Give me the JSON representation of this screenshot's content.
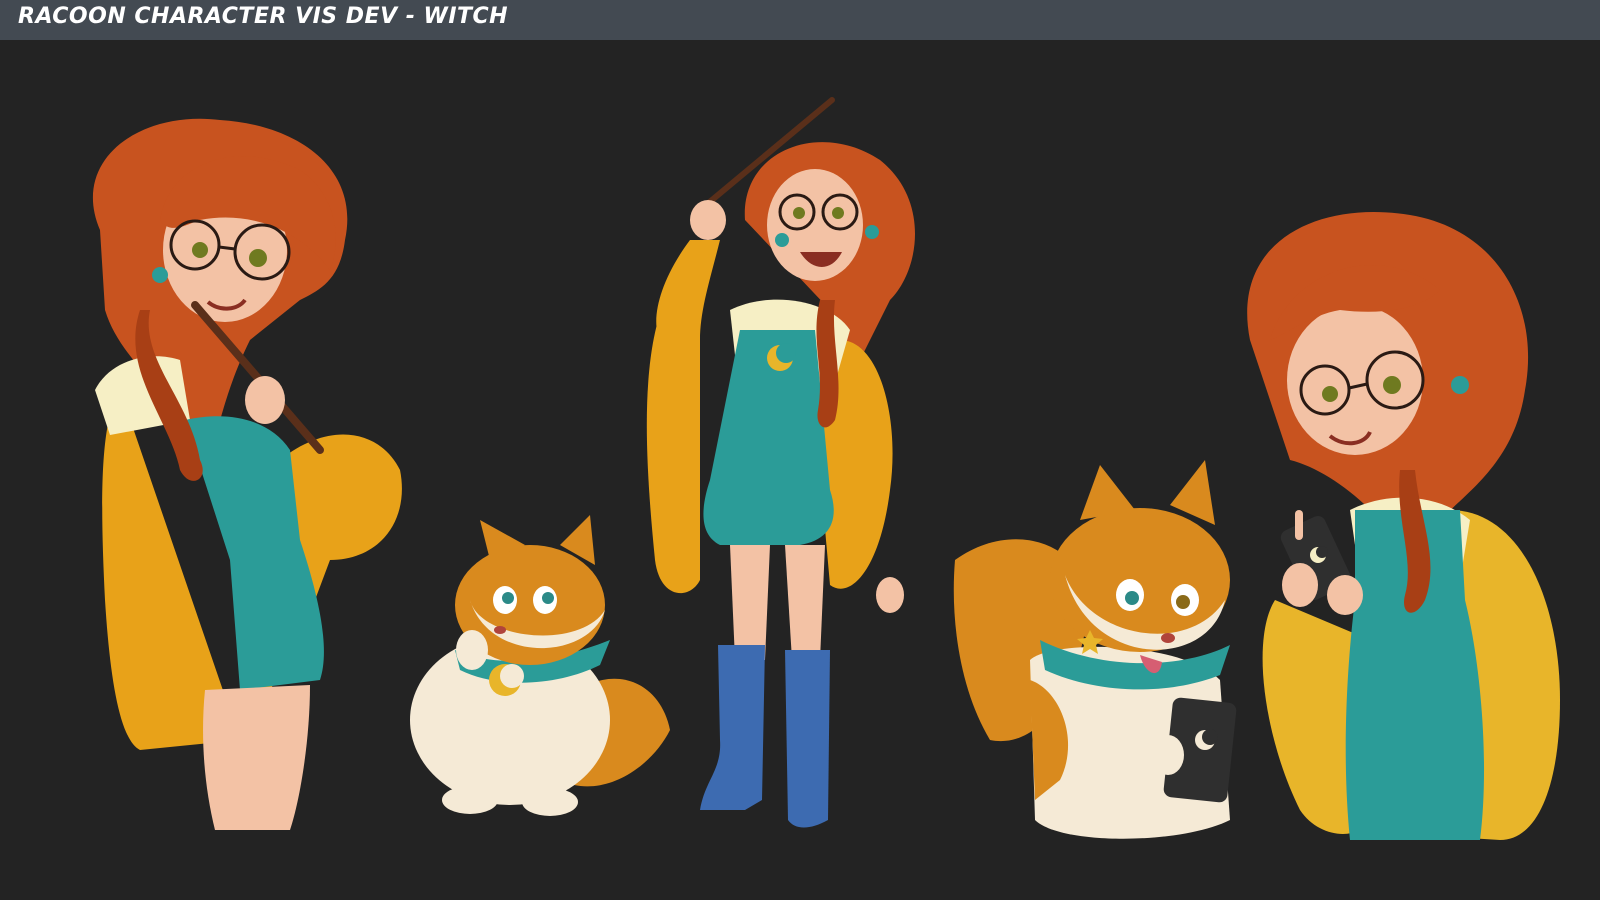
{
  "header": {
    "title": "Racoon Character Vis Dev - Witch"
  },
  "palette": {
    "background": "#232323",
    "header_bar": "#434a52",
    "hair": "#c8531f",
    "cardigan": "#e8a219",
    "dress": "#2b9c98",
    "shirt": "#f6efc5",
    "skin": "#f3c2a5",
    "boots": "#3d6bb1",
    "raccoon_fur": "#d98a1e",
    "raccoon_belly": "#f5ead6"
  },
  "artwork": {
    "figures": [
      {
        "icon": "witch-thinking-with-wand-icon"
      },
      {
        "icon": "raccoon-thinking-icon"
      },
      {
        "icon": "witch-full-body-wand-raised-icon"
      },
      {
        "icon": "raccoon-with-phone-icon"
      },
      {
        "icon": "witch-with-phone-icon"
      }
    ]
  }
}
